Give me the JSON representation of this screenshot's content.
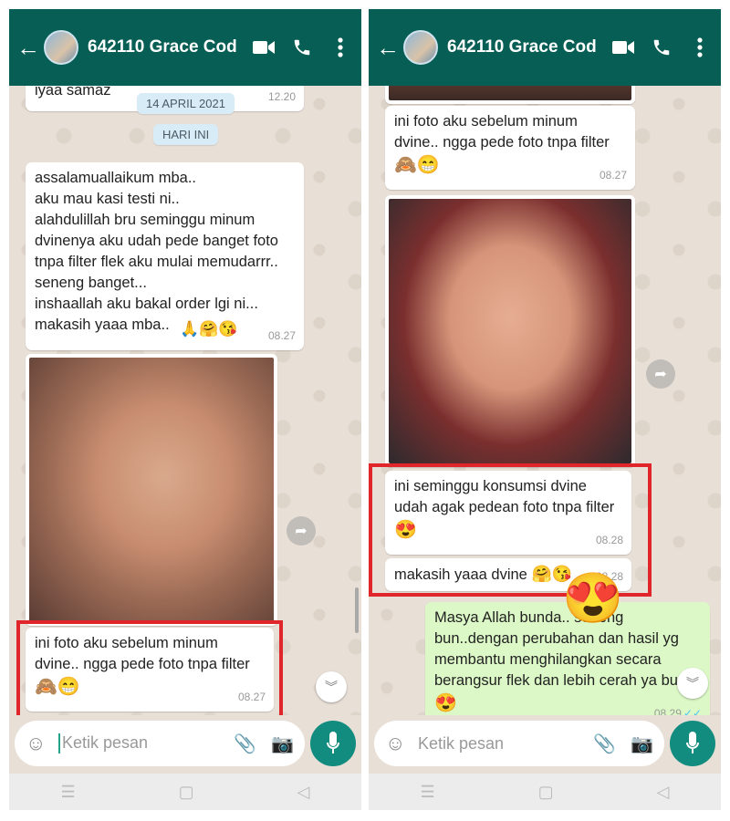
{
  "left": {
    "contact": "642110 Grace Cod",
    "partial_msg": "iyaa samaz",
    "partial_time": "12.20",
    "date_chip": "14 APRIL 2021",
    "today_chip": "HARI INI",
    "msg1": {
      "text": "assalamuallaikum mba..\naku mau kasi testi ni..\nalahdulillah bru seminggu minum\ndvinenya aku udah pede banget foto\ntnpa filter flek aku mulai memudarrr..\nseneng banget...\ninshaallah aku bakal order lgi ni...\nmakasih yaaa mba..",
      "emojis": "🙏🤗😘",
      "time": "08.27"
    },
    "msg2": {
      "text": "ini foto aku sebelum minum\ndvine.. ngga pede foto tnpa filter",
      "emojis": "🙈😁",
      "time": "08.27"
    },
    "input_placeholder": "Ketik pesan"
  },
  "right": {
    "contact": "642110 Grace Cod",
    "msg1": {
      "text": "ini foto aku sebelum minum\ndvine.. ngga pede foto tnpa filter",
      "emojis": "🙈😁",
      "time": "08.27"
    },
    "msg2": {
      "text": "ini seminggu konsumsi dvine\nudah agak pedean foto tnpa filter",
      "emojis": "😍",
      "time": "08.28"
    },
    "msg3": {
      "text": "makasih yaaa dvine",
      "emojis": "🤗😘",
      "time": "08.28"
    },
    "reply": {
      "text": "Masya Allah bunda..         seneng\nbun..dengan perubahan dan hasil yg\nmembantu menghilangkan secara\nberangsur flek dan lebih cerah ya bun",
      "emojis": "😍",
      "time": "08.29",
      "ticks": "✓✓"
    },
    "overlay_emoji": "😍",
    "input_placeholder": "Ketik pesan"
  },
  "icons": {
    "back": "arrow-left-icon",
    "video": "video-call-icon",
    "phone": "phone-icon",
    "menu": "more-vert-icon",
    "emoji": "smiley-icon",
    "attach": "paperclip-icon",
    "camera": "camera-icon",
    "mic": "microphone-icon"
  },
  "colors": {
    "header": "#075e54",
    "outgoing_bubble": "#dcf8c6",
    "highlight_box": "#e0262b",
    "mic_button": "#128c7e"
  }
}
